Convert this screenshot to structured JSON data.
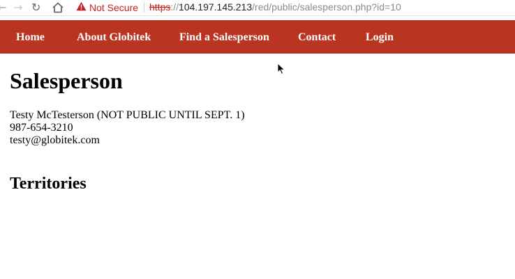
{
  "browser": {
    "security_label": "Not Secure",
    "url_scheme": "https",
    "url_separator": "://",
    "url_host": "104.197.145.213",
    "url_path": "/red/public/salesperson.php?id=10"
  },
  "nav": {
    "items": [
      {
        "label": "Home"
      },
      {
        "label": "About Globitek"
      },
      {
        "label": "Find a Salesperson"
      },
      {
        "label": "Contact"
      },
      {
        "label": "Login"
      }
    ],
    "background": "#b93522"
  },
  "main": {
    "title": "Salesperson",
    "name_line": "Testy McTesterson (NOT PUBLIC UNTIL SEPT. 1)",
    "phone": "987-654-3210",
    "email": "testy@globitek.com",
    "territories_heading": "Territories"
  }
}
